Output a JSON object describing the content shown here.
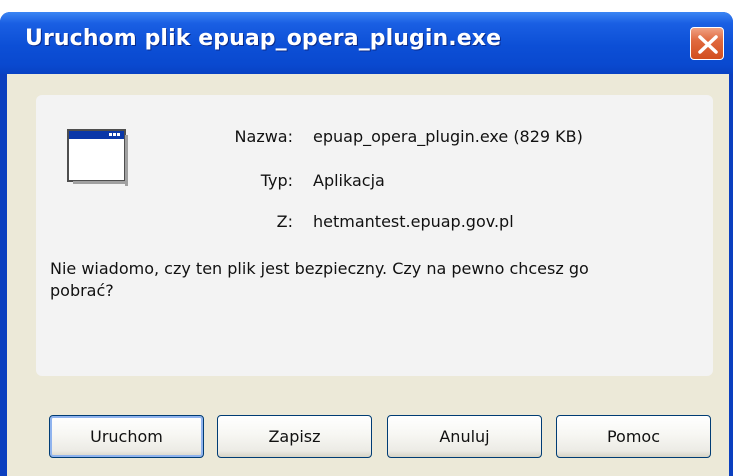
{
  "window": {
    "title": "Uruchom plik epuap_opera_plugin.exe"
  },
  "file_info": {
    "name_label": "Nazwa:",
    "name_value": "epuap_opera_plugin.exe (829 KB)",
    "type_label": "Typ:",
    "type_value": "Aplikacja",
    "from_label": "Z:",
    "from_value": "hetmantest.epuap.gov.pl"
  },
  "message": "Nie wiadomo, czy ten plik jest bezpieczny. Czy na pewno chcesz go pobrać?",
  "buttons": {
    "run": "Uruchom",
    "save": "Zapisz",
    "cancel": "Anuluj",
    "help": "Pomoc"
  },
  "icons": {
    "file": "application-window-icon",
    "close": "close-icon"
  },
  "colors": {
    "titlebar": "#0c4fd6",
    "close_button": "#d24e1e",
    "dialog_background": "#ece9d8"
  }
}
